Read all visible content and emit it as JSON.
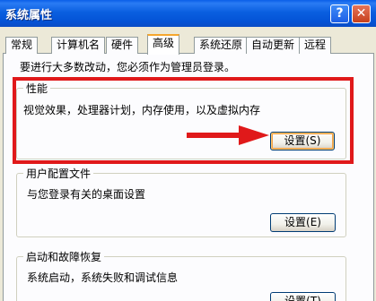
{
  "window": {
    "title": "系统属性",
    "help_label": "?",
    "close_label": "✕"
  },
  "tabs": [
    {
      "label": "常规"
    },
    {
      "label": "计算机名"
    },
    {
      "label": "硬件"
    },
    {
      "label": "高级"
    },
    {
      "label": "系统还原"
    },
    {
      "label": "自动更新"
    },
    {
      "label": "远程"
    }
  ],
  "active_tab": "高级",
  "notice": "要进行大多数改动，您必须作为管理员登录。",
  "performance": {
    "label": "性能",
    "description": "视觉效果，处理器计划，内存使用，以及虚拟内存",
    "button": "设置(S)"
  },
  "user_profiles": {
    "label": "用户配置文件",
    "description": "与您登录有关的桌面设置",
    "button": "设置(E)"
  },
  "startup_recovery": {
    "label": "启动和故障恢复",
    "description": "系统启动，系统失败和调试信息",
    "button": "设置(T)"
  },
  "colors": {
    "titlebar": "#0a5fe0",
    "highlight_box": "#e0191a",
    "active_tab_accent": "#f6a72e"
  }
}
